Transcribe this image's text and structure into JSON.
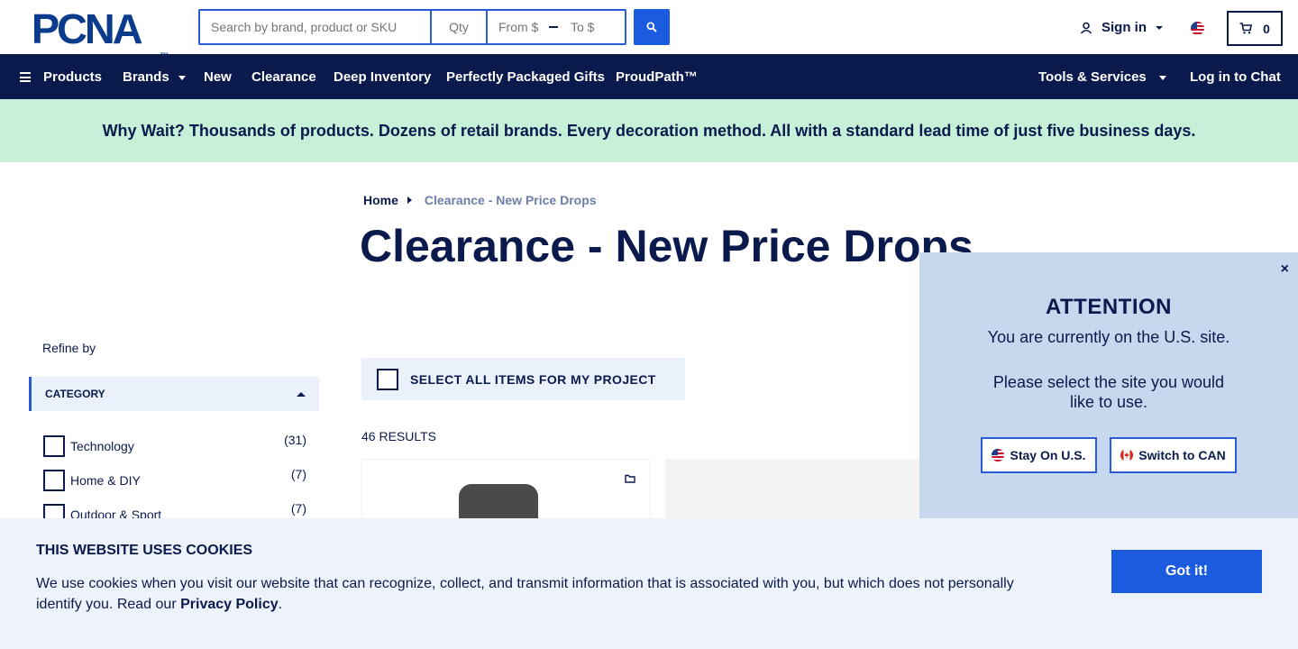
{
  "header": {
    "logo_text": "PCNA",
    "search_placeholder": "Search by brand, product or SKU",
    "qty_placeholder": "Qty",
    "price_from_placeholder": "From $",
    "price_to_placeholder": "To $",
    "signin_label": "Sign in",
    "cart_count": "0",
    "search_icon": "search-icon",
    "user_icon": "user-icon",
    "cart_icon": "cart-icon",
    "flag_icon": "us-flag-icon"
  },
  "nav": {
    "products": "Products",
    "brands": "Brands",
    "new": "New",
    "clearance": "Clearance",
    "deep_inventory": "Deep Inventory",
    "perfectly_packaged": "Perfectly Packaged Gifts",
    "proudpath": "ProudPath™",
    "tools_services": "Tools & Services",
    "log_in_chat": "Log in to Chat"
  },
  "promo": {
    "text": "Why Wait? Thousands of products. Dozens of retail brands. Every decoration method. All with a standard lead time of just five business days."
  },
  "breadcrumb": {
    "home": "Home",
    "current": "Clearance - New Price Drops"
  },
  "page": {
    "title": "Clearance - New Price Drops",
    "results": "46 RESULTS",
    "select_all": "SELECT ALL ITEMS FOR MY PROJECT"
  },
  "sidebar": {
    "refine_label": "Refine by",
    "category_header": "CATEGORY",
    "categories": [
      {
        "label": "Technology",
        "count": "(31)"
      },
      {
        "label": "Home & DIY",
        "count": "(7)"
      },
      {
        "label": "Outdoor & Sport",
        "count": "(7)"
      }
    ]
  },
  "attention": {
    "close": "×",
    "title": "ATTENTION",
    "message1": "You are currently on the U.S. site.",
    "message2": "Please select the site you would like to use.",
    "stay_us": "Stay On U.S.",
    "switch_can": "Switch to CAN"
  },
  "cookie": {
    "title": "THIS WEBSITE USES COOKIES",
    "text": "We use cookies when you visit our website that can recognize, collect, and transmit information that is associated with you, but which does not personally identify you. Read our",
    "link": "Privacy Policy",
    "period": ".",
    "button": "Got it!"
  },
  "colors": {
    "navy": "#0b1a4d",
    "brand_blue": "#1a5be0",
    "promo_green": "#c6f0d8",
    "panel_blue": "#c6d7ee",
    "cookie_bg": "#edf2fb"
  }
}
